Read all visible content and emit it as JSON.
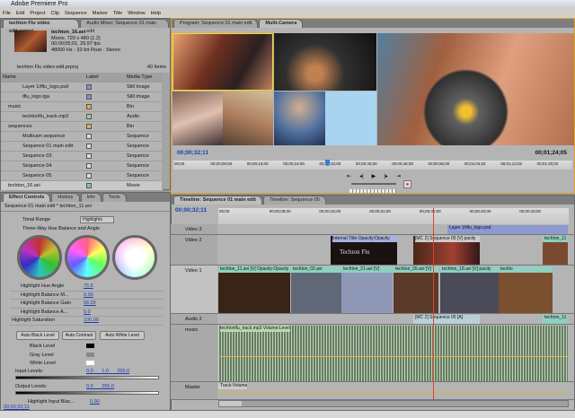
{
  "app": {
    "title": "Adobe Premiere Pro"
  },
  "menu": [
    "File",
    "Edit",
    "Project",
    "Clip",
    "Sequence",
    "Marker",
    "Title",
    "Window",
    "Help"
  ],
  "project": {
    "tabs": [
      "techton Flu video edit.prproj",
      "Audio Mixer: Sequence 01 main edit"
    ],
    "clip_name": "techton_16.avi",
    "clip_info": [
      "Movie, 720 x 480 (1.2)",
      "00;00;05;01, 29.97 fps",
      "48000 Hz - 32-bit Float - Stereo"
    ],
    "path": "techton Flu video edit.prproj",
    "count": "40 Items",
    "columns": [
      "Name",
      "Label",
      "Media Type"
    ],
    "items": [
      {
        "name": "Layer 1/tflu_logo.psd",
        "label_color": "#8c8cd0",
        "type": "Still Image"
      },
      {
        "name": "tflu_logo.tga",
        "label_color": "#8c8cd0",
        "type": "Still Image"
      },
      {
        "name": "music",
        "label_color": "#e0b050",
        "type": "Bin"
      },
      {
        "name": "techtonflu_track.mp3",
        "label_color": "#9ad09a",
        "type": "Audio"
      },
      {
        "name": "sequences",
        "label_color": "#e0b050",
        "type": "Bin"
      },
      {
        "name": "Multicam sequence",
        "label_color": "#dddddd",
        "type": "Sequence"
      },
      {
        "name": "Sequence 01 main edit",
        "label_color": "#dddddd",
        "type": "Sequence"
      },
      {
        "name": "Sequence 03",
        "label_color": "#dddddd",
        "type": "Sequence"
      },
      {
        "name": "Sequence 04",
        "label_color": "#dddddd",
        "type": "Sequence"
      },
      {
        "name": "Sequence 05",
        "label_color": "#dddddd",
        "type": "Sequence"
      },
      {
        "name": "techton_16.avi",
        "label_color": "#80c8b0",
        "type": "Movie"
      }
    ]
  },
  "effects": {
    "tabs": [
      "Effect Controls",
      "History",
      "Info",
      "Tools"
    ],
    "sequence": "Sequence 01 main edit * techton_11.avi",
    "tonal_range_label": "Tonal Range",
    "tonal_range_value": "Highlights",
    "wheel_title": "Three-Way Hue Balance and Angle",
    "params": [
      {
        "label": "Highlight Hue Angle",
        "value": "75.5"
      },
      {
        "label": "Highlight Balance M...",
        "value": "0.00"
      },
      {
        "label": "Highlight Balance Gain",
        "value": "56.00"
      },
      {
        "label": "Highlight Balance A...",
        "value": "0.0"
      },
      {
        "label": "Highlight Saturation",
        "value": "100.00"
      }
    ],
    "buttons": [
      "Auto Black Level",
      "Auto Contrast",
      "Auto White Level"
    ],
    "levels": [
      "Black Level",
      "Gray Level",
      "White Level"
    ],
    "input_label": "Input Levels:",
    "input_values": [
      "0.0",
      "1.0",
      "255.0"
    ],
    "output_label": "Output Levels:",
    "output_values": [
      "0.0",
      "255.0"
    ],
    "last_param": {
      "label": "Highlight Input Blac...",
      "value": "0.00"
    },
    "timecode": "00;00;32;11"
  },
  "monitor": {
    "tabs": [
      "Program: Sequence 01 main edit",
      "Multi-Camera"
    ],
    "timecode": "00;00;32;11",
    "duration": "00;01;24;05",
    "ruler": [
      "00;00",
      "00;00;08;00",
      "00;00;16;00",
      "00;00;24;00",
      "00;00;32;00",
      "00;00;40;00",
      "00;00;48;00",
      "00;00;56;00",
      "00;01;04;02",
      "00;01;12;02",
      "00;01;20;02"
    ],
    "playhead_fraction": 0.38
  },
  "timeline": {
    "tabs": [
      "Timeline: Sequence 01 main edit",
      "Timeline: Sequence 05"
    ],
    "timecode": "00;00;32;11",
    "ruler": [
      "00;00",
      "00;00;08;00",
      "00;00;16;00",
      "00;00;24;00",
      "00;00;32;00",
      "00;00;40;00",
      "00;00;48;00"
    ],
    "tracks": {
      "v3": "Video 3",
      "v2": "Video 2",
      "v1": "Video 1",
      "a2": "Audio 2",
      "music": "music",
      "master": "Master"
    },
    "clips": {
      "v3": "Layer 1/tflu_logo.psd",
      "v2": [
        "Internal Title Opacity:Opacity",
        "[MC 2] Sequence 05 [V] pacity",
        "techton_11"
      ],
      "title_text": "Techton Flu",
      "v1": [
        "techton_11.avi [V] Opacity:Opacity",
        "techton_02.avi",
        "techton_21.avi [V]",
        "techton_05.avi [V]",
        "techton_18.avi [V] pacity",
        "techto"
      ],
      "a2": [
        "[MC 2] Sequence 05 [A]",
        "techton_11"
      ],
      "music": "techtonflu_track.mp3 Volume:Level",
      "master": "Track:Volume"
    }
  }
}
